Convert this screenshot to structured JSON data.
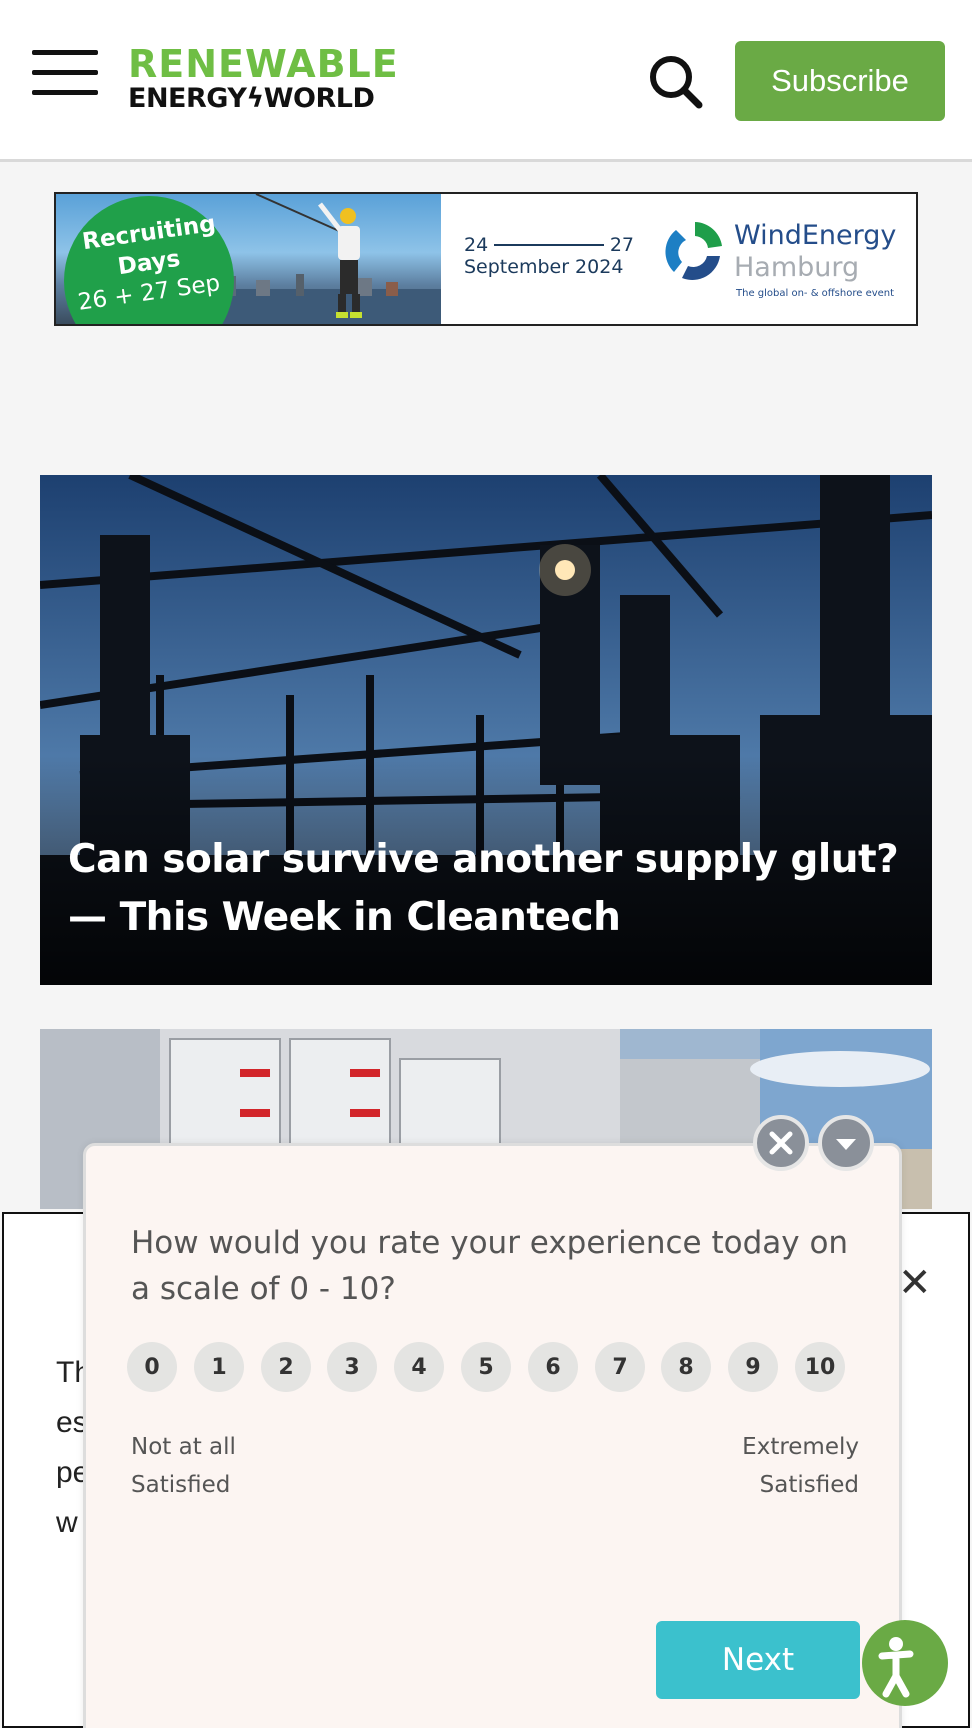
{
  "header": {
    "logo_top": "RENEWABLE",
    "logo_bottom_left": "ENERGY",
    "logo_bottom_right": "WORLD",
    "subscribe_label": "Subscribe",
    "brand_color": "#6aaa45"
  },
  "banner": {
    "badge_line1": "Recruiting",
    "badge_line2": "Days",
    "badge_line3": "26 + 27 Sep",
    "date_start": "24",
    "date_end": "27",
    "date_month": "September 2024",
    "event_name1": "WindEnergy",
    "event_name2": "Hamburg",
    "event_tagline": "The global on- & offshore event"
  },
  "articles": [
    {
      "title": "Can solar survive another supply glut? — This Week in Cleantech"
    }
  ],
  "underlying_modal": {
    "text_fragments": [
      "Th",
      "es",
      "pe",
      "w"
    ]
  },
  "survey": {
    "question": "How would you rate your experience today on a scale of 0 - 10?",
    "scale": [
      "0",
      "1",
      "2",
      "3",
      "4",
      "5",
      "6",
      "7",
      "8",
      "9",
      "10"
    ],
    "low_label_line1": "Not at all",
    "low_label_line2": "Satisfied",
    "high_label_line1": "Extremely",
    "high_label_line2": "Satisfied",
    "next_label": "Next",
    "accent_color": "#3bc1cd"
  }
}
